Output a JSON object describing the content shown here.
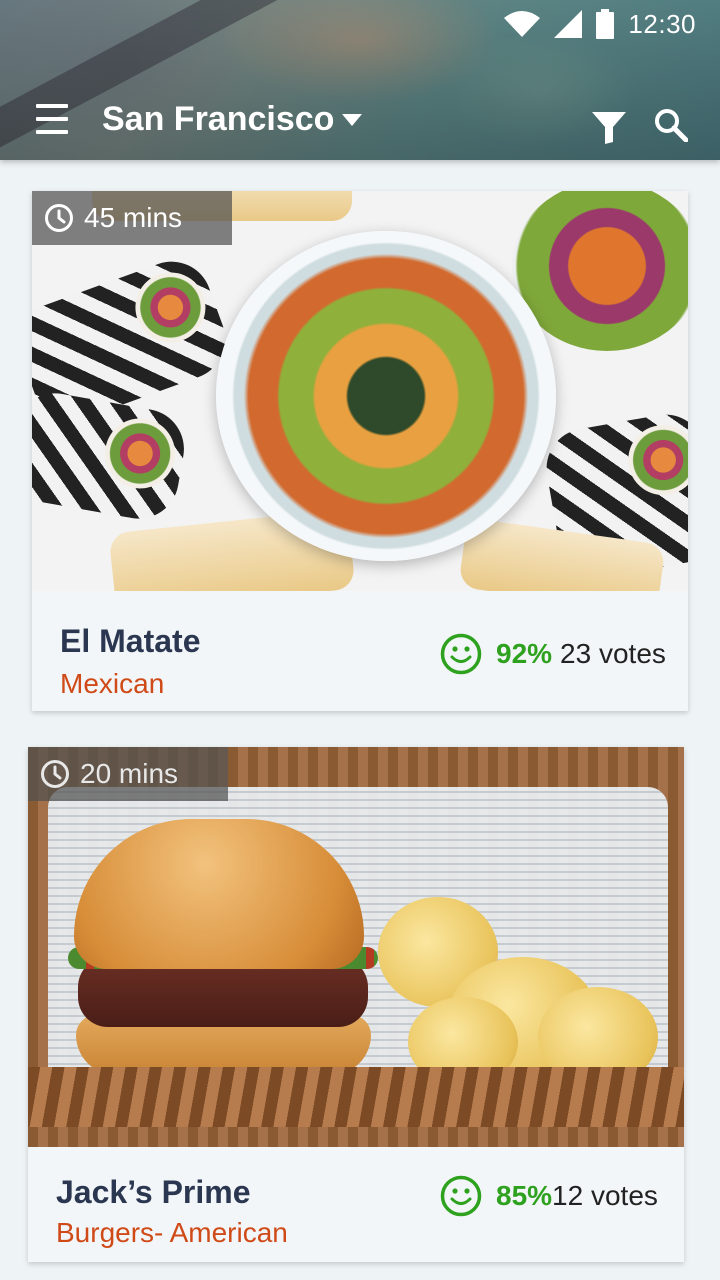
{
  "status_bar": {
    "time": "12:30"
  },
  "header": {
    "city": "San Francisco"
  },
  "restaurants": [
    {
      "delivery_time": "45 mins",
      "name": "El Matate",
      "cuisine": "Mexican",
      "rating_percent": "92%",
      "votes": "23 votes"
    },
    {
      "delivery_time": "20 mins",
      "name": "Jack’s Prime",
      "cuisine": "Burgers- American",
      "rating_percent": "85%",
      "votes": "12 votes"
    }
  ],
  "colors": {
    "name": "#2b3650",
    "cuisine": "#d04a18",
    "rating_positive": "#2ea21f"
  },
  "icons": [
    "menu-icon",
    "dropdown-caret-icon",
    "filter-icon",
    "search-icon",
    "wifi-icon",
    "signal-icon",
    "battery-icon",
    "clock-icon",
    "smiley-icon"
  ]
}
